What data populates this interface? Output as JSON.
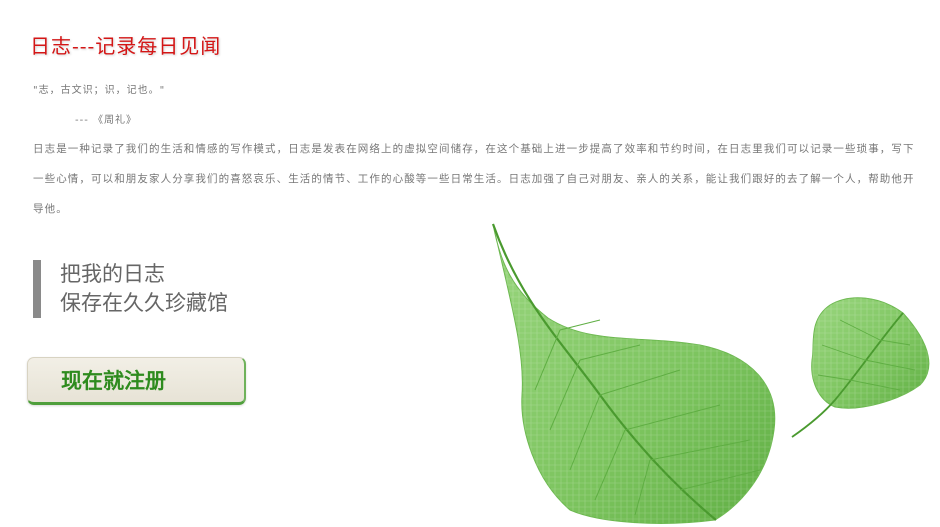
{
  "header": {
    "title": "日志---记录每日见闻"
  },
  "intro": {
    "quote": "\"志，古文识；识，记也。\"",
    "source": "---  《周礼》",
    "paragraph": "日志是一种记录了我们的生活和情感的写作模式，日志是发表在网络上的虚拟空间储存，在这个基础上进一步提高了效率和节约时间，在日志里我们可以记录一些琐事，写下一些心情，可以和朋友家人分享我们的喜怒哀乐、生活的情节、工作的心酸等一些日常生活。日志加强了自己对朋友、亲人的关系，能让我们跟好的去了解一个人，帮助他开导他。"
  },
  "slogan": {
    "line1": "把我的日志",
    "line2": "保存在久久珍藏馆"
  },
  "cta": {
    "register_label": "现在就注册"
  },
  "colors": {
    "title": "#d41616",
    "body_text": "#777777",
    "slogan_bar": "#8a8a8a",
    "button_text": "#2e8b1e",
    "leaf": "#7cc45e"
  },
  "icons": [
    "large-leaf-icon",
    "small-leaf-icon"
  ]
}
